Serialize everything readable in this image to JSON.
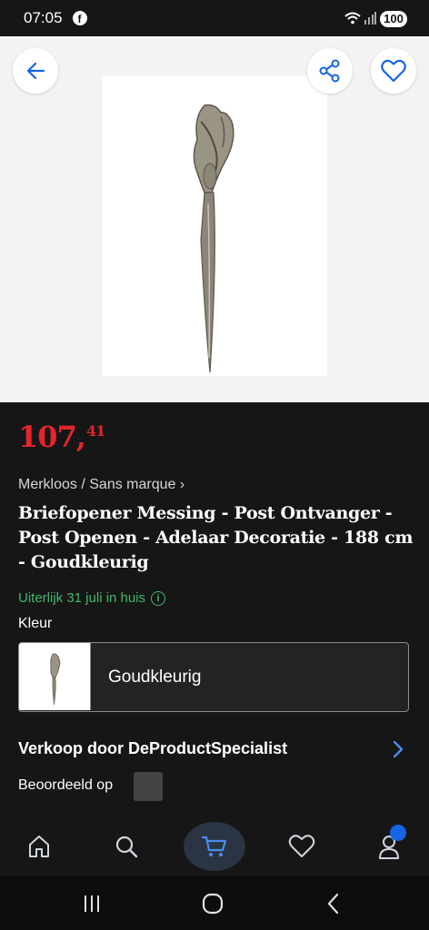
{
  "status_bar": {
    "time": "07:05",
    "battery": "100",
    "icons": [
      "facebook-icon",
      "wifi-icon",
      "signal-icon",
      "battery-icon"
    ]
  },
  "product": {
    "price_main": "107,",
    "price_cents": "41",
    "brand_line": "Merkloos / Sans marque",
    "title": "Briefopener Messing - Post Ontvanger - Post Openen - Adelaar Decoratie - 188 cm - Goudkleurig",
    "delivery": "Uiterlijk 31 juli in huis",
    "color_label": "Kleur",
    "color_selected": "Goudkleurig",
    "seller": "Verkoop door DeProductSpecialist",
    "rated_label": "Beoordeeld op"
  },
  "colors": {
    "price": "#e6242b",
    "delivery": "#3fb86d",
    "accent": "#1664e6",
    "background": "#161616"
  },
  "header_icons": [
    "back-arrow-icon",
    "share-icon",
    "heart-icon"
  ],
  "bottom_nav": [
    "home-icon",
    "search-icon",
    "cart-icon",
    "heart-icon",
    "account-icon"
  ]
}
